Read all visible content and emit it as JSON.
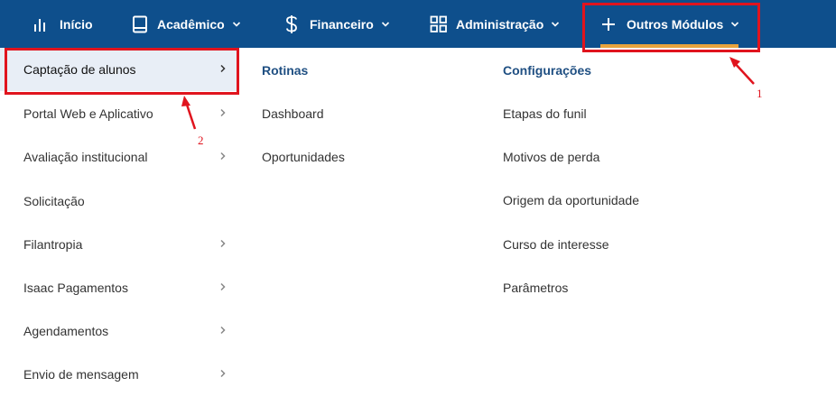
{
  "nav": {
    "items": [
      {
        "label": "Início",
        "icon": "bar-chart-icon"
      },
      {
        "label": "Acadêmico",
        "icon": "book-icon"
      },
      {
        "label": "Financeiro",
        "icon": "dollar-icon"
      },
      {
        "label": "Administração",
        "icon": "grid-icon"
      },
      {
        "label": "Outros Módulos",
        "icon": "plus-icon"
      }
    ],
    "accent": "#e8a33d",
    "background": "#0e4f8c"
  },
  "left_menu": [
    {
      "label": "Captação de alunos"
    },
    {
      "label": "Portal Web e Aplicativo"
    },
    {
      "label": "Avaliação institucional"
    },
    {
      "label": "Solicitação"
    },
    {
      "label": "Filantropia"
    },
    {
      "label": "Isaac Pagamentos"
    },
    {
      "label": "Agendamentos"
    },
    {
      "label": "Envio de mensagem"
    }
  ],
  "rotinas": {
    "title": "Rotinas",
    "items": [
      "Dashboard",
      "Oportunidades"
    ]
  },
  "configuracoes": {
    "title": "Configurações",
    "items": [
      "Etapas do funil",
      "Motivos de perda",
      "Origem da oportunidade",
      "Curso de interesse",
      "Parâmetros"
    ]
  },
  "annotations": {
    "one": "1",
    "two": "2",
    "color": "#e0141e"
  }
}
